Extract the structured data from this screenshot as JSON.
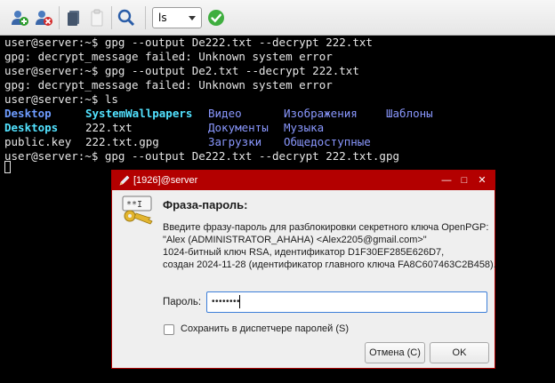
{
  "toolbar": {
    "command_select": {
      "value": "ls"
    },
    "icons": [
      "add-user-icon",
      "remove-user-icon",
      "copy-icon",
      "paste-icon",
      "search-icon",
      "confirm-icon"
    ]
  },
  "terminal": {
    "lines": [
      "user@server:~$ gpg --output De222.txt --decrypt 222.txt",
      "gpg: decrypt_message failed: Unknown system error",
      "user@server:~$ gpg --output De2.txt --decrypt 222.txt",
      "gpg: decrypt_message failed: Unknown system error",
      "user@server:~$ ls"
    ],
    "ls_rows": [
      [
        "Desktop",
        "SystemWallpapers",
        "Видео",
        "Изображения",
        "Шаблоны"
      ],
      [
        "Desktops",
        "222.txt",
        "Документы",
        "Музыка"
      ],
      [
        "public.key",
        "222.txt.gpg",
        "Загрузки",
        "Общедоступные"
      ]
    ],
    "last_command": "user@server:~$ gpg --output De222.txt --decrypt 222.txt.gpg"
  },
  "dialog": {
    "title": "[1926]@server",
    "heading": "Фраза-пароль:",
    "description": [
      "Введите фразу-пароль для разблокировки секретного ключа OpenPGP:",
      "\"Alex (ADMINISTRATOR_AHAHA) <Alex2205@gmail.com>\"",
      "1024-битный ключ RSA, идентификатор D1F30EF285E626D7,",
      "создан 2024-11-28 (идентификатор главного ключа FA8C607463C2B458)."
    ],
    "password_label": "Пароль:",
    "password_value": "••••••••",
    "save_label": "Сохранить в диспетчере паролей (S)",
    "cancel_label": "Отмена (C)",
    "ok_label": "OK",
    "colors": {
      "titlebar": "#b30000",
      "border": "#b00000",
      "focus": "#3d7fd9"
    }
  }
}
